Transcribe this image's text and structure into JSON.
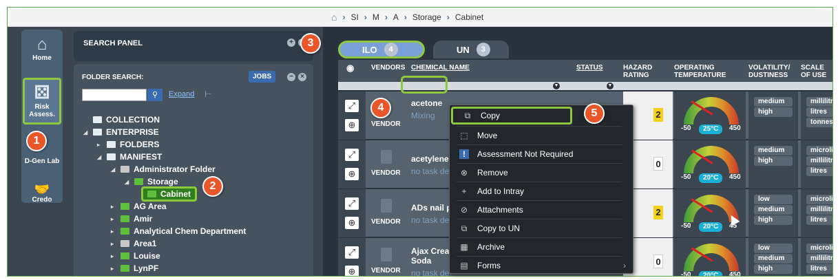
{
  "breadcrumb": {
    "items": [
      "SI",
      "M",
      "A",
      "Storage",
      "Cabinet"
    ]
  },
  "nav": {
    "home": "Home",
    "risk": "Risk Assess.",
    "dgen": "D-Gen Lab",
    "credo": "Credo"
  },
  "search_panel": {
    "title": "SEARCH PANEL"
  },
  "folder_search": {
    "label": "FOLDER SEARCH:",
    "jobs": "JOBS",
    "expand": "Expand",
    "search_value": ""
  },
  "tree": [
    {
      "label": "COLLECTION"
    },
    {
      "label": "ENTERPRISE"
    },
    {
      "label": "FOLDERS"
    },
    {
      "label": "MANIFEST"
    },
    {
      "label": "Administrator Folder"
    },
    {
      "label": "Storage"
    },
    {
      "label": "Cabinet"
    },
    {
      "label": "AG Area"
    },
    {
      "label": "Amir"
    },
    {
      "label": "Analytical Chem Department"
    },
    {
      "label": "Area1"
    },
    {
      "label": "Louise"
    },
    {
      "label": "LynPF"
    }
  ],
  "tabs": [
    {
      "label": "ILO",
      "count": "4"
    },
    {
      "label": "UN",
      "count": "3"
    }
  ],
  "columns": {
    "vendors": "VENDORS",
    "chemical": "CHEMICAL NAME",
    "status": "STATUS",
    "hazard1": "HAZARD",
    "hazard2": "RATING",
    "optemp1": "OPERATING",
    "optemp2": "TEMPERATURE",
    "vol1": "VOLATILITY/",
    "vol2": "DUSTINESS",
    "scale1": "SCALE",
    "scale2": "OF USE"
  },
  "rows": [
    {
      "vendor": "VENDOR",
      "name": "acetone",
      "task": "Mixing",
      "hazard": "2",
      "gauge": {
        "min": "-50",
        "max": "450",
        "temp": "25°C"
      },
      "vol": [
        "medium",
        "high"
      ],
      "scale": [
        "millilitres",
        "litres",
        "tonnes"
      ]
    },
    {
      "vendor": "VENDOR",
      "name": "acetylene",
      "task": "no task de",
      "hazard": "0",
      "gauge": {
        "min": "-50",
        "max": "450",
        "temp": "20°C"
      },
      "vol": [
        "medium",
        "high"
      ],
      "scale": [
        "microlitres",
        "millilitres",
        "litres"
      ]
    },
    {
      "vendor": "VENDOR",
      "name": "ADs nail p",
      "task": "no task de",
      "hazard": "2",
      "gauge": {
        "min": "-50",
        "max": "45",
        "temp": "20°C"
      },
      "vol": [
        "low",
        "medium",
        "high"
      ],
      "scale": [
        "microlitres",
        "millilitres",
        "litres"
      ]
    },
    {
      "vendor": "VENDOR",
      "name": "Ajax Crea",
      "name2": "Soda",
      "task": "no task de",
      "hazard": "0",
      "gauge": {
        "min": "-50",
        "max": "450",
        "temp": "20°C"
      },
      "vol": [
        "low",
        "medium",
        "high"
      ],
      "scale": [
        "microlitres",
        "millilitres",
        "litres"
      ]
    }
  ],
  "menu": {
    "items": [
      {
        "label": "Copy",
        "icon": "copy-icon"
      },
      {
        "label": "Move",
        "icon": "move-icon"
      },
      {
        "label": "Assessment Not Required",
        "icon": "info-icon"
      },
      {
        "label": "Remove",
        "icon": "remove-icon"
      },
      {
        "label": "Add to Intray",
        "icon": "plus-icon"
      },
      {
        "label": "Attachments",
        "icon": "paperclip-icon"
      },
      {
        "label": "Copy to UN",
        "icon": "copy-icon"
      },
      {
        "label": "Archive",
        "icon": "archive-icon"
      },
      {
        "label": "Forms",
        "icon": "forms-icon"
      }
    ]
  },
  "badges": [
    "1",
    "2",
    "3",
    "4",
    "5"
  ],
  "colors": {
    "highlight": "#8dc83f",
    "badge": "#e8562a",
    "hazard_yellow": "#f4d21c"
  }
}
